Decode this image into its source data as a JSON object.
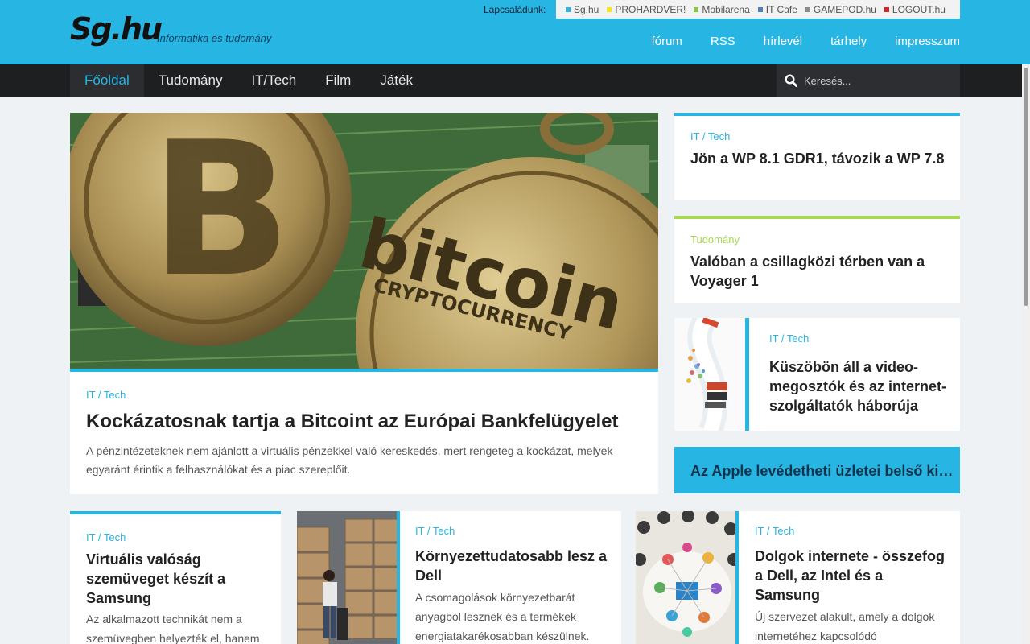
{
  "site": {
    "logo": "Sg.hu",
    "tagline": "Informatika és tudomány"
  },
  "family": {
    "label": "Lapcsaládunk:",
    "sites": [
      {
        "name": "Sg.hu",
        "color": "#27b6e4"
      },
      {
        "name": "PROHARDVER!",
        "color": "#f3e61b"
      },
      {
        "name": "Mobilarena",
        "color": "#8ac44a"
      },
      {
        "name": "IT Cafe",
        "color": "#4a7fb8"
      },
      {
        "name": "GAMEPOD.hu",
        "color": "#8a8a8a"
      },
      {
        "name": "LOGOUT.hu",
        "color": "#d8232a"
      }
    ]
  },
  "header_links": [
    "fórum",
    "RSS",
    "hírlevél",
    "tárhely",
    "impresszum"
  ],
  "nav": {
    "items": [
      "Főoldal",
      "Tudomány",
      "IT/Tech",
      "Film",
      "Játék"
    ],
    "active": "Főoldal"
  },
  "search": {
    "placeholder": "Keresés..."
  },
  "hero": {
    "image": "bitcoin-coins-image",
    "category": "IT / Tech",
    "title": "Kockázatosnak tartja a Bitcoint az Európai Bankfelügyelet",
    "description": "A pénzintézeteknek nem ajánlott a virtuális pénzekkel való kereskedés, mert rengeteg a kockázat, melyek egyaránt érintik a felhasználókat és a piac szereplőit.",
    "coin_text_1": "bitcoin",
    "coin_text_2": "CRYPTOCURRENCY"
  },
  "side": [
    {
      "category": "IT / Tech",
      "title": "Jön a WP 8.1 GDR1, távozik a WP 7.8",
      "color": "#27b6e4"
    },
    {
      "category": "Tudomány",
      "title": "Valóban a csillagközi térben van a Voyager 1",
      "color": "#a6d950"
    },
    {
      "category": "IT / Tech",
      "title": "Küszöbön áll a video-megosztók és az internet-szolgáltatók háborúja",
      "color": "#27b6e4",
      "image": "cable-stream-image"
    },
    {
      "title": "Az Apple levédetheti üzletei belső kialakítását",
      "color": "#27b6e4"
    }
  ],
  "bottom": [
    {
      "category": "IT / Tech",
      "title": "Virtuális valóság szemüveget készít a Samsung",
      "description": "Az alkalmazott technikát nem a szemüvegben helyezték el, hanem"
    },
    {
      "category": "IT / Tech",
      "title": "Környezettudatosabb lesz a Dell",
      "description": "A csomagolások környezetbarát anyagból lesznek és a termékek energiatakarékosabban készülnek.",
      "image": "dell-warehouse-image"
    },
    {
      "category": "IT / Tech",
      "title": "Dolgok internete - összefog a Dell, az Intel és a Samsung",
      "description": "Új szervezet alakult, amely a dolgok internetéhez kapcsolódó",
      "image": "internet-of-things-image"
    }
  ]
}
